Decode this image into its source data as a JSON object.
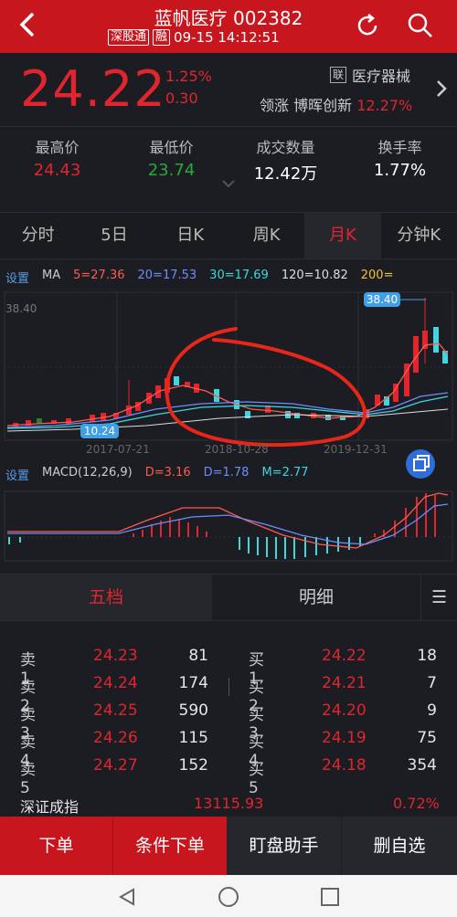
{
  "header": {
    "title": "蓝帆医疗 002382",
    "tag1": "深股通",
    "tag2": "融",
    "datetime": "09-15 14:12:51"
  },
  "quote": {
    "price": "24.22",
    "pct": "1.25%",
    "change": "0.30",
    "industry_tag": "联",
    "industry": "医疗器械",
    "lead_label": "领涨 博晖创新",
    "lead_pct": "12.27%"
  },
  "stats": [
    {
      "label": "最高价",
      "value": "24.43",
      "color": "#e0252f"
    },
    {
      "label": "最低价",
      "value": "23.74",
      "color": "#2aa83a"
    },
    {
      "label": "成交数量",
      "value": "12.42万",
      "color": "#ffffff"
    },
    {
      "label": "换手率",
      "value": "1.77%",
      "color": "#ffffff"
    }
  ],
  "tabs": [
    "分时",
    "5日",
    "日K",
    "周K",
    "月K",
    "分钟K"
  ],
  "ma": {
    "settings": "设置",
    "label": "MA",
    "ma5": "5=27.36",
    "ma20": "20=17.53",
    "ma30": "30=17.69",
    "ma120": "120=10.82",
    "ma200": "200="
  },
  "kchart": {
    "y_top": "38.40",
    "max_badge": "38.40",
    "min_badge": "10.24",
    "dates": [
      "2017-07-21",
      "2018-10-28",
      "2019-12-31"
    ]
  },
  "macd": {
    "settings": "设置",
    "label": "MACD(12,26,9)",
    "d": "D=3.16",
    "dd": "D=1.78",
    "m": "M=2.77"
  },
  "subtabs": [
    "五档",
    "明细",
    "☰"
  ],
  "book": {
    "sells": [
      {
        "label": "卖1",
        "price": "24.23",
        "vol": "81"
      },
      {
        "label": "卖2",
        "price": "24.24",
        "vol": "174"
      },
      {
        "label": "卖3",
        "price": "24.25",
        "vol": "590"
      },
      {
        "label": "卖4",
        "price": "24.26",
        "vol": "115"
      },
      {
        "label": "卖5",
        "price": "24.27",
        "vol": "152"
      }
    ],
    "buys": [
      {
        "label": "买1",
        "price": "24.22",
        "vol": "18"
      },
      {
        "label": "买2",
        "price": "24.21",
        "vol": "7"
      },
      {
        "label": "买3",
        "price": "24.20",
        "vol": "9"
      },
      {
        "label": "买4",
        "price": "24.19",
        "vol": "75"
      },
      {
        "label": "买5",
        "price": "24.18",
        "vol": "354"
      }
    ]
  },
  "index": {
    "name": "深证成指",
    "value": "13115.93",
    "pct": "0.72%"
  },
  "bottom": [
    "下单",
    "条件下单",
    "盯盘助手",
    "删自选"
  ],
  "colors": {
    "up": "#e0252f",
    "down": "#2aa83a",
    "brand": "#c8161e"
  }
}
